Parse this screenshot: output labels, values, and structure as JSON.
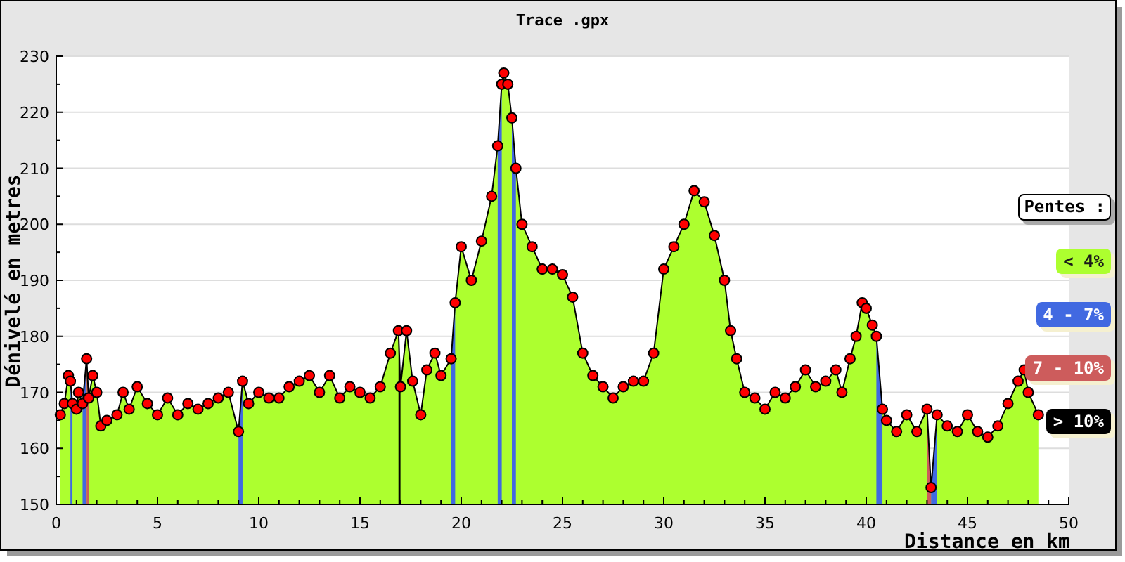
{
  "chart_data": {
    "type": "area",
    "title": "Trace .gpx",
    "xlabel": "Distance en km",
    "ylabel": "Dénivelé en metres",
    "x": [
      0.2,
      0.4,
      0.6,
      0.7,
      0.8,
      1.0,
      1.1,
      1.3,
      1.5,
      1.6,
      1.8,
      2.0,
      2.2,
      2.5,
      3.0,
      3.3,
      3.6,
      4.0,
      4.5,
      5.0,
      5.5,
      6.0,
      6.5,
      7.0,
      7.5,
      8.0,
      8.5,
      9.0,
      9.2,
      9.5,
      10.0,
      10.5,
      11.0,
      11.5,
      12.0,
      12.5,
      13.0,
      13.5,
      14.0,
      14.5,
      15.0,
      15.5,
      16.0,
      16.5,
      16.9,
      17.0,
      17.3,
      17.6,
      18.0,
      18.3,
      18.7,
      19.0,
      19.5,
      19.7,
      20.0,
      20.5,
      21.0,
      21.5,
      21.8,
      22.0,
      22.1,
      22.3,
      22.5,
      22.7,
      23.0,
      23.5,
      24.0,
      24.5,
      25.0,
      25.5,
      26.0,
      26.5,
      27.0,
      27.5,
      28.0,
      28.5,
      29.0,
      29.5,
      30.0,
      30.5,
      31.0,
      31.5,
      32.0,
      32.5,
      33.0,
      33.3,
      33.6,
      34.0,
      34.5,
      35.0,
      35.5,
      36.0,
      36.5,
      37.0,
      37.5,
      38.0,
      38.5,
      38.8,
      39.2,
      39.5,
      39.8,
      40.0,
      40.3,
      40.5,
      40.8,
      41.0,
      41.5,
      42.0,
      42.5,
      43.0,
      43.2,
      43.5,
      44.0,
      44.5,
      45.0,
      45.5,
      46.0,
      46.5,
      47.0,
      47.5,
      47.8,
      48.0,
      48.5
    ],
    "series": [
      {
        "color": "#adff2f",
        "values": [
          166,
          168,
          173,
          172,
          168,
          167,
          170,
          168,
          176,
          169,
          173,
          170,
          164,
          165,
          166,
          170,
          167,
          171,
          168,
          166,
          169,
          166,
          168,
          167,
          168,
          169,
          170,
          163,
          172,
          168,
          170,
          169,
          169,
          171,
          172,
          173,
          170,
          173,
          169,
          171,
          170,
          169,
          171,
          177,
          181,
          171,
          181,
          172,
          166,
          174,
          177,
          173,
          176,
          186,
          196,
          190,
          197,
          205,
          214,
          225,
          227,
          225,
          219,
          210,
          200,
          196,
          192,
          192,
          191,
          187,
          177,
          173,
          171,
          169,
          171,
          172,
          172,
          177,
          192,
          196,
          200,
          206,
          204,
          198,
          190,
          181,
          176,
          170,
          169,
          167,
          170,
          169,
          171,
          174,
          171,
          172,
          174,
          170,
          176,
          180,
          186,
          185,
          182,
          180,
          167,
          165,
          163,
          166,
          163,
          167,
          153,
          166,
          164,
          163,
          166,
          163,
          162,
          164,
          168,
          172,
          174,
          170,
          166
        ]
      },
      {
        "color": "#4169e1",
        "values": [
          null,
          null,
          null,
          172,
          168,
          null,
          null,
          168,
          176,
          null,
          null,
          null,
          null,
          null,
          null,
          null,
          null,
          null,
          null,
          null,
          null,
          null,
          null,
          null,
          null,
          null,
          null,
          163,
          172,
          null,
          null,
          null,
          null,
          null,
          null,
          null,
          null,
          null,
          null,
          null,
          null,
          null,
          null,
          null,
          null,
          null,
          null,
          null,
          null,
          null,
          null,
          null,
          176,
          186,
          null,
          null,
          null,
          null,
          214,
          225,
          null,
          null,
          219,
          210,
          null,
          null,
          null,
          null,
          null,
          null,
          null,
          null,
          null,
          null,
          null,
          null,
          null,
          null,
          null,
          null,
          null,
          null,
          null,
          null,
          null,
          null,
          null,
          null,
          null,
          null,
          null,
          null,
          null,
          null,
          null,
          null,
          null,
          null,
          null,
          null,
          null,
          null,
          null,
          180,
          167,
          null,
          null,
          null,
          null,
          null,
          153,
          166,
          null,
          null,
          null,
          null,
          null,
          null,
          null,
          null,
          null,
          null,
          null
        ]
      },
      {
        "color": "#cd5c5c",
        "values": [
          null,
          null,
          null,
          null,
          null,
          null,
          null,
          null,
          176,
          169,
          null,
          null,
          null,
          null,
          null,
          null,
          null,
          null,
          null,
          null,
          null,
          null,
          null,
          null,
          null,
          null,
          null,
          null,
          null,
          null,
          null,
          null,
          null,
          null,
          null,
          null,
          null,
          null,
          null,
          null,
          null,
          null,
          null,
          null,
          null,
          null,
          null,
          null,
          null,
          null,
          null,
          null,
          null,
          null,
          null,
          null,
          null,
          null,
          null,
          null,
          null,
          null,
          null,
          null,
          null,
          null,
          null,
          null,
          null,
          null,
          null,
          null,
          null,
          null,
          null,
          null,
          null,
          null,
          null,
          null,
          null,
          null,
          null,
          null,
          null,
          null,
          null,
          null,
          null,
          null,
          null,
          null,
          null,
          null,
          null,
          null,
          null,
          null,
          null,
          null,
          null,
          null,
          null,
          null,
          null,
          null,
          null,
          null,
          null,
          167,
          153,
          null,
          null,
          null,
          null,
          null,
          null,
          null,
          null,
          null,
          null,
          null,
          null
        ]
      },
      {
        "color": "#000000",
        "values": [
          null,
          null,
          null,
          null,
          null,
          null,
          null,
          null,
          null,
          null,
          null,
          null,
          null,
          null,
          null,
          null,
          null,
          null,
          null,
          null,
          null,
          null,
          null,
          null,
          null,
          null,
          null,
          null,
          null,
          null,
          null,
          null,
          null,
          null,
          null,
          null,
          null,
          null,
          null,
          null,
          null,
          null,
          null,
          null,
          181,
          171,
          null,
          null,
          null,
          null,
          null,
          null,
          null,
          null,
          null,
          null,
          null,
          null,
          null,
          null,
          null,
          null,
          null,
          null,
          null,
          null,
          null,
          null,
          null,
          null,
          null,
          null,
          null,
          null,
          null,
          null,
          null,
          null,
          null,
          null,
          null,
          null,
          null,
          null,
          null,
          null,
          null,
          null,
          null,
          null,
          null,
          null,
          null,
          null,
          null,
          null,
          null,
          null,
          null,
          null,
          null,
          null,
          null,
          null,
          null,
          null,
          null,
          null,
          null,
          null,
          null,
          null,
          null,
          null,
          null,
          null,
          null,
          null,
          null,
          null,
          null,
          null,
          null
        ]
      }
    ],
    "grid": true,
    "xlim": [
      0,
      50
    ],
    "ylim": [
      150,
      230
    ],
    "xticks": [
      0,
      5,
      10,
      15,
      20,
      25,
      30,
      35,
      40,
      45,
      50
    ],
    "yticks": [
      150,
      160,
      170,
      180,
      190,
      200,
      210,
      220,
      230
    ]
  },
  "legend": {
    "title": "Pentes :",
    "items": [
      {
        "label": "< 4%",
        "color": "#adff2f"
      },
      {
        "label": "4 - 7%",
        "color": "#4169e1"
      },
      {
        "label": "7 - 10%",
        "color": "#cd5c5c"
      },
      {
        "label": "> 10%",
        "color": "#000000"
      }
    ]
  }
}
